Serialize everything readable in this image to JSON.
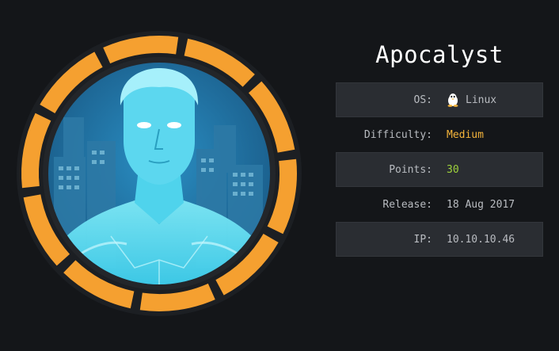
{
  "machine": {
    "name": "Apocalyst"
  },
  "info": [
    {
      "label": "OS:",
      "value": "Linux",
      "icon": "tux-icon"
    },
    {
      "label": "Difficulty:",
      "value": "Medium",
      "color": "#f5b53b"
    },
    {
      "label": "Points:",
      "value": "30",
      "color": "#9fd33c"
    },
    {
      "label": "Release:",
      "value": "18 Aug 2017"
    },
    {
      "label": "IP:",
      "value": "10.10.10.46"
    }
  ],
  "colors": {
    "ring": "#f5a030",
    "background": "#141619",
    "row_alt": "#2a2d32"
  }
}
